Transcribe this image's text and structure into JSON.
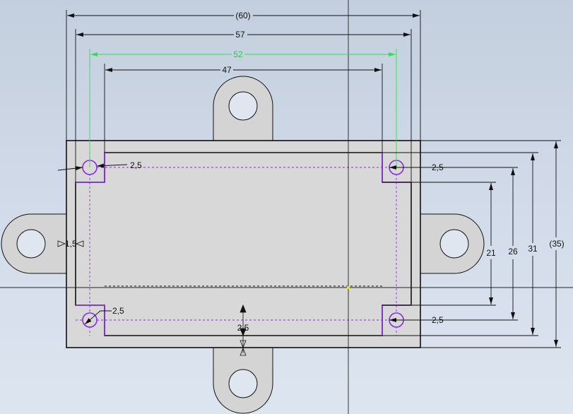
{
  "colors": {
    "background_top": "#c3cfde",
    "background_bottom": "#dde5f0",
    "part_fill": "#d8d8d8",
    "tab_fill": "#d4d4d4",
    "outline": "#111111",
    "construction": "#8a2be2",
    "driven_dimension": "#33dd55",
    "origin_axis": "#222222",
    "origin_point": "#e8e800"
  },
  "dimensions": {
    "overall_width": "(60)",
    "outer_width": "57",
    "hole_spacing_width": "52",
    "inner_width": "47",
    "inner_height": "21",
    "hole_spacing_height": "26",
    "outer_height": "31",
    "overall_height": "(35)",
    "hole_dia_top_left": "2,5",
    "hole_dia_top_right": "2,5",
    "hole_dia_bottom_left": "2,5",
    "hole_dia_bottom_right": "2,5",
    "wall_left": "1,5",
    "wall_bottom": "2,5"
  }
}
